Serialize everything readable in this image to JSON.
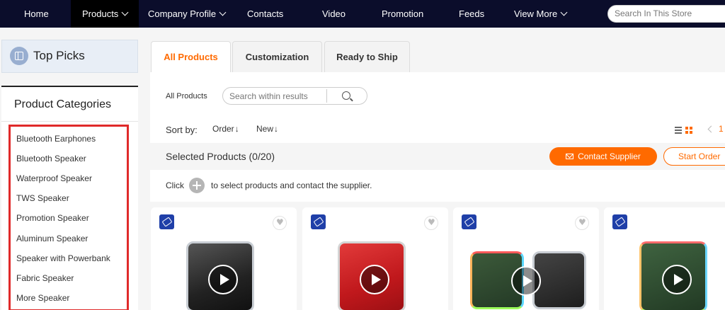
{
  "nav": {
    "items": [
      {
        "label": "Home",
        "has_dropdown": false,
        "active": false
      },
      {
        "label": "Products",
        "has_dropdown": true,
        "active": true
      },
      {
        "label": "Company Profile",
        "has_dropdown": true,
        "active": false
      },
      {
        "label": "Contacts",
        "has_dropdown": false,
        "active": false
      },
      {
        "label": "Video",
        "has_dropdown": false,
        "active": false
      },
      {
        "label": "Promotion",
        "has_dropdown": false,
        "active": false
      },
      {
        "label": "Feeds",
        "has_dropdown": false,
        "active": false
      },
      {
        "label": "View More",
        "has_dropdown": true,
        "active": false
      }
    ],
    "search_placeholder": "Search In This Store"
  },
  "sidebar": {
    "top_picks": "Top Picks",
    "categories_title": "Product Categories",
    "categories": [
      "Bluetooth Earphones",
      "Bluetooth Speaker",
      "Waterproof Speaker",
      "TWS Speaker",
      "Promotion Speaker",
      "Aluminum Speaker",
      "Speaker with Powerbank",
      "Fabric Speaker",
      "More Speaker"
    ]
  },
  "tabs": [
    "All Products",
    "Customization",
    "Ready to Ship"
  ],
  "main": {
    "breadcrumb": "All Products",
    "results_search_placeholder": "Search within results",
    "sort_label": "Sort by:",
    "sort_order": "Order",
    "sort_new": "New",
    "sort_arrow": "↓",
    "page_number": "1",
    "selected_products": "Selected Products (0/20)",
    "contact_supplier": "Contact Supplier",
    "start_order": "Start Order",
    "hint_click": "Click",
    "hint_rest": "to select products and contact the supplier."
  },
  "colors": {
    "nav_bg": "#0b0d2b",
    "accent": "#ff6a00",
    "highlight_border": "#e02a2a",
    "badge_blue": "#1f3fa8"
  },
  "icons": [
    "chevron-down-icon",
    "grid-icon",
    "search-icon",
    "list-view-icon",
    "grid-view-icon",
    "chevron-left-icon",
    "mail-icon",
    "plus-circle-icon",
    "heart-icon",
    "play-icon"
  ]
}
